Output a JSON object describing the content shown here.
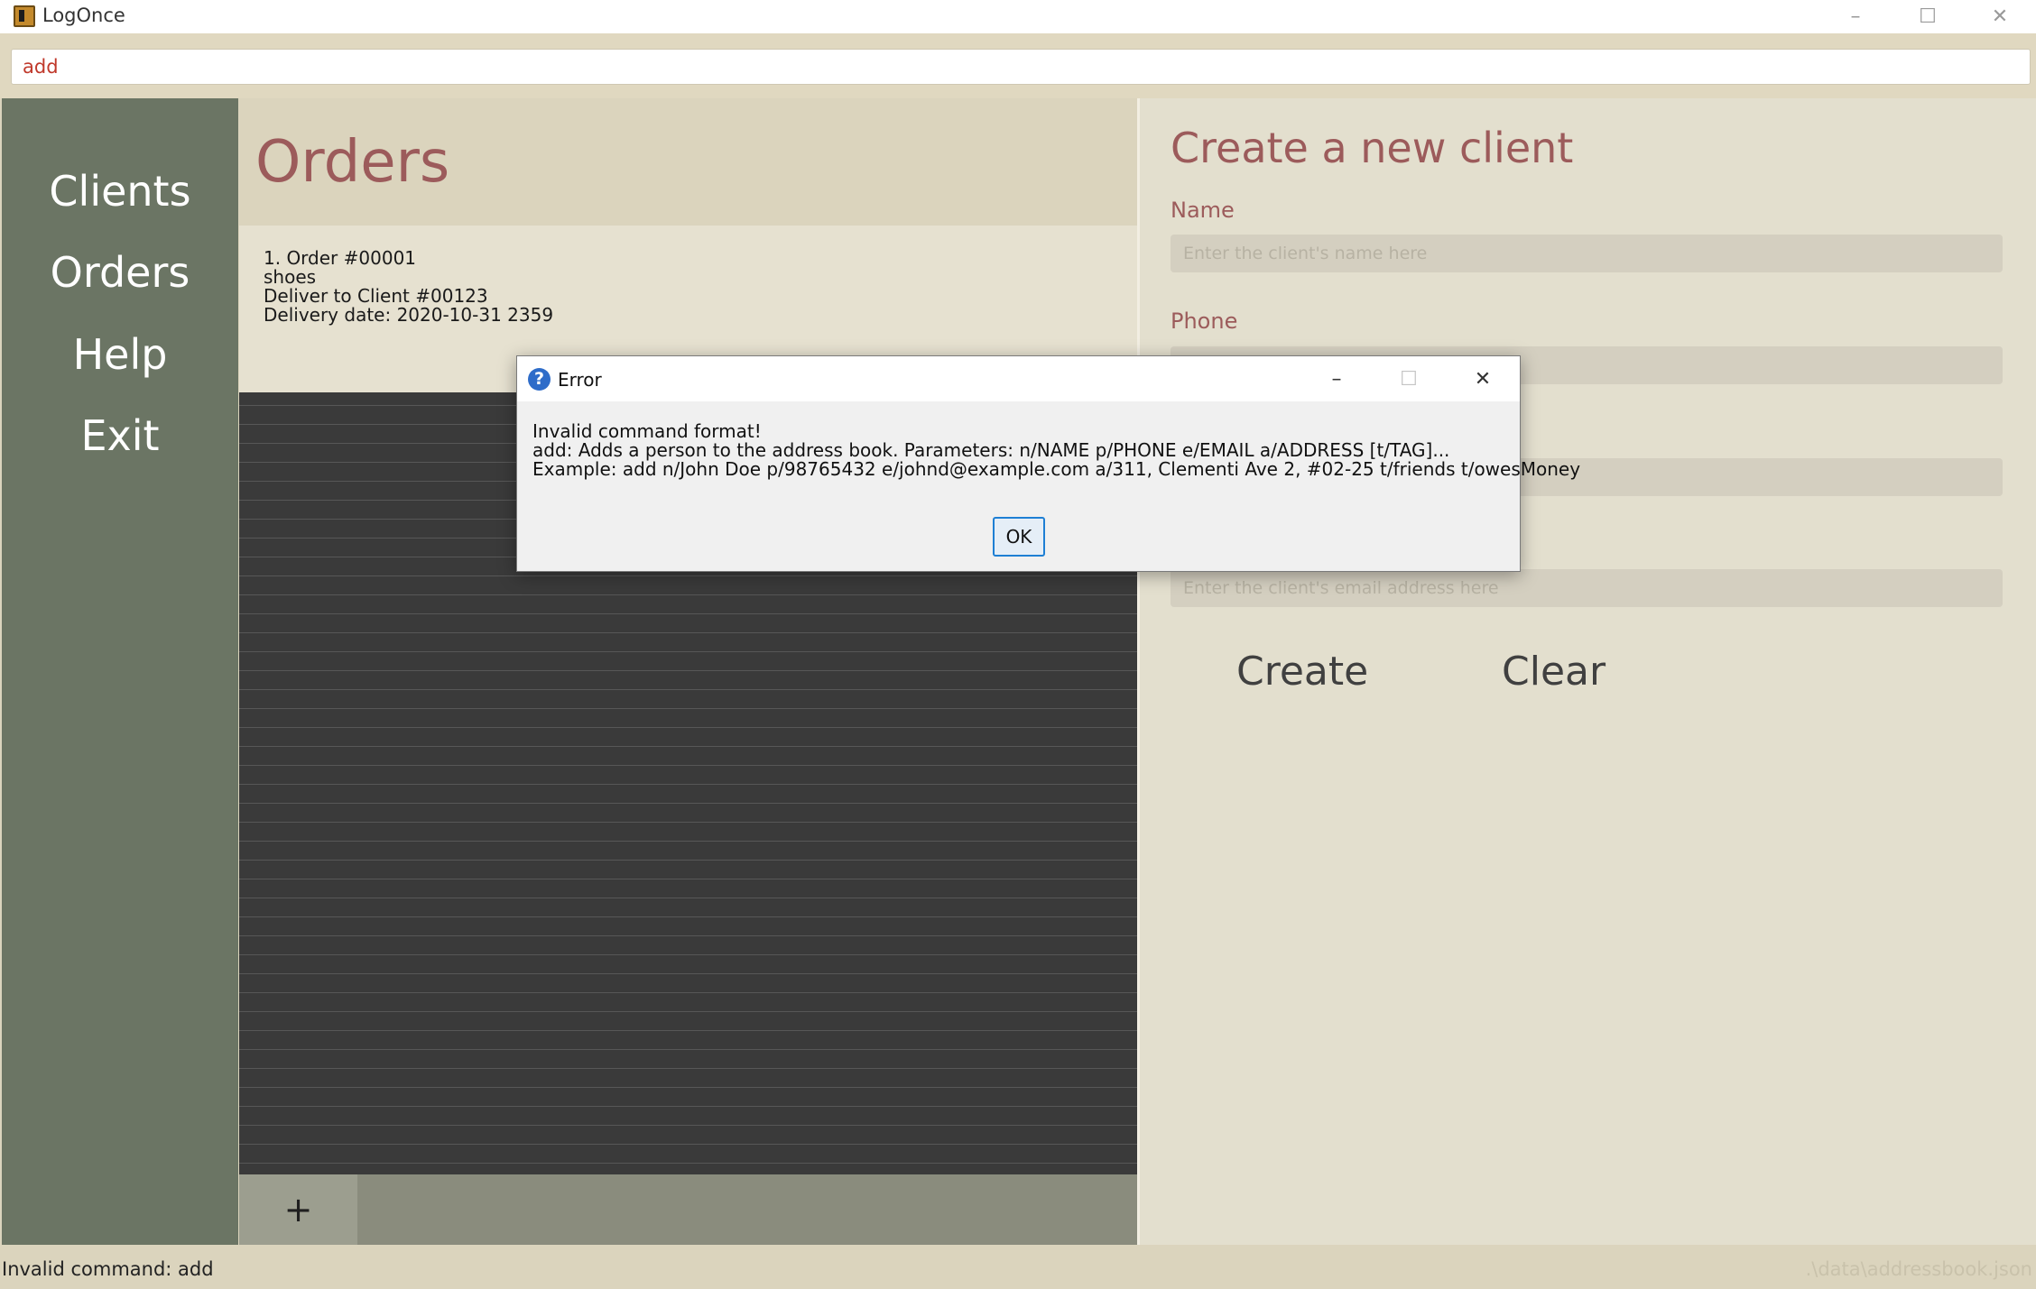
{
  "window": {
    "title": "LogOnce",
    "controls": {
      "minimize": "–",
      "maximize": "☐",
      "close": "✕"
    }
  },
  "command": {
    "value": "add"
  },
  "sidebar": {
    "items": [
      {
        "label": "Clients"
      },
      {
        "label": "Orders"
      },
      {
        "label": "Help"
      },
      {
        "label": "Exit"
      }
    ]
  },
  "orders": {
    "title": "Orders",
    "list": [
      {
        "index_title": "1.  Order #00001",
        "item": "shoes",
        "deliver_to": "Deliver to Client #00123",
        "delivery_date": "Delivery date: 2020-10-31 2359"
      }
    ],
    "add_button": "+"
  },
  "form": {
    "title": "Create a new client",
    "fields": {
      "name": {
        "label": "Name",
        "placeholder": "Enter the client's name here"
      },
      "phone": {
        "label": "Phone",
        "placeholder": ""
      },
      "address": {
        "label": "",
        "placeholder": ""
      },
      "email": {
        "label": "",
        "placeholder": "Enter the client's email address here"
      }
    },
    "create_button": "Create",
    "clear_button": "Clear"
  },
  "status": {
    "message": "Invalid command: add",
    "file_path": ".\\data\\addressbook.json"
  },
  "dialog": {
    "title": "Error",
    "icon": "?",
    "lines": [
      "Invalid command format!",
      "add: Adds a person to the address book. Parameters: n/NAME p/PHONE e/EMAIL a/ADDRESS [t/TAG]...",
      "Example: add n/John Doe p/98765432 e/johnd@example.com a/311, Clementi Ave 2, #02-25 t/friends t/owesMoney"
    ],
    "ok_label": "OK",
    "controls": {
      "minimize": "–",
      "maximize": "☐",
      "close": "✕"
    }
  },
  "colors": {
    "accent": "#9c5b5b",
    "sidebar": "#6b7564",
    "command_text": "#c0392b",
    "ok_border": "#1e7fd4"
  }
}
